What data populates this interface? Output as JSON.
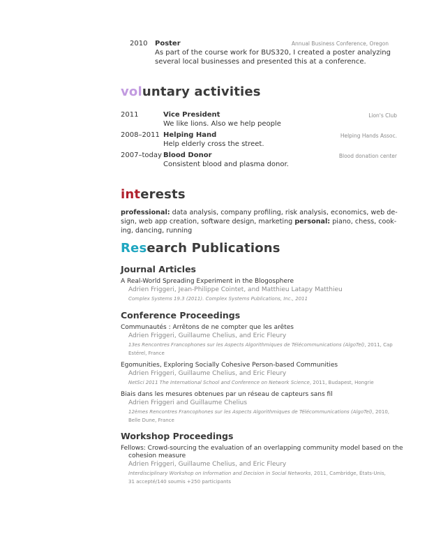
{
  "top_entry": {
    "year": "2010",
    "title": "Poster",
    "org": "Annual Business Conference, Oregon",
    "desc_line1": "As part of the course work for BUS320, I created a poster analyzing",
    "desc_line2": "several local businesses and presented this at a conference."
  },
  "voluntary": {
    "heading_accent": "vol",
    "heading_rest": "untary activities",
    "accent_color": "#c29be0",
    "entries": [
      {
        "year": "2011",
        "title": "Vice President",
        "org": "Lion's Club",
        "desc": "We like lions.  Also we help people"
      },
      {
        "year": "2008–2011",
        "title": "Helping Hand",
        "org": "Helping Hands Assoc.",
        "desc": "Help elderly cross the street."
      },
      {
        "year": "2007–today",
        "title": "Blood Donor",
        "org": "Blood donation center",
        "desc": "Consistent blood and plasma donor."
      }
    ]
  },
  "interests": {
    "heading_accent": "int",
    "heading_rest": "erests",
    "accent_color": "#b0202c",
    "professional_label": "professional:",
    "line1": " data analysis, company profiling, risk analysis, economics, web de-",
    "line2a": "sign, web app creation, software design, marketing ",
    "personal_label": "personal:",
    "line2b": " piano, chess, cook-",
    "line3": "ing, dancing, running"
  },
  "research": {
    "heading_accent": "Res",
    "heading_rest": "earch Publications",
    "accent_color": "#1fa6c0",
    "journal": {
      "heading": "Journal Articles",
      "items": [
        {
          "title": "A Real-World Spreading Experiment in the Blogosphere",
          "authors": "Adrien Friggeri, Jean-Philippe Cointet, and Matthieu Latapy Matthieu",
          "venue": "Complex Systems 19.3 (2011). Complex Systems Publications, Inc., 2011"
        }
      ]
    },
    "conference": {
      "heading": "Conference Proceedings",
      "items": [
        {
          "title": "Communautés : Arrêtons de ne compter que les arêtes",
          "authors": "Adrien Friggeri, Guillaume Chelius, and Eric Fleury",
          "venue_italic": "13es Rencontres Francophones sur les Aspects Algorithmiques de Télécommunications (AlgoTel)",
          "venue_plain": ", 2011, Cap",
          "venue_line2": "Estérel, France"
        },
        {
          "title": "Egomunities, Exploring Socially Cohesive Person-based Communities",
          "authors": "Adrien Friggeri, Guillaume Chelius, and Eric Fleury",
          "venue_italic": "NetSci 2011 The International School and Conference on Network Science",
          "venue_plain": ", 2011, Budapest, Hongrie",
          "venue_line2": ""
        },
        {
          "title": "Biais dans les mesures obtenues par un réseau de capteurs sans fil",
          "authors": "Adrien Friggeri and Guillaume Chelius",
          "venue_italic": "12èmes Rencontres Francophones sur les Aspects Algorithmiques de Télécommunications (AlgoTel)",
          "venue_plain": ", 2010,",
          "venue_line2": "Belle Dune, France"
        }
      ]
    },
    "workshop": {
      "heading": "Workshop Proceedings",
      "items": [
        {
          "title_line1": "Fellows: Crowd-sourcing the evaluation of an overlapping community model based on the",
          "title_line2": "cohesion measure",
          "authors": "Adrien Friggeri, Guillaume Chelius, and Eric Fleury",
          "venue_italic": "Interdisciplinary Workshop on Information and Decision in Social Networks",
          "venue_plain": ", 2011, Cambridge, États-Unis,",
          "venue_line2": "31 accepté/140 soumis +250 participants"
        }
      ]
    }
  }
}
